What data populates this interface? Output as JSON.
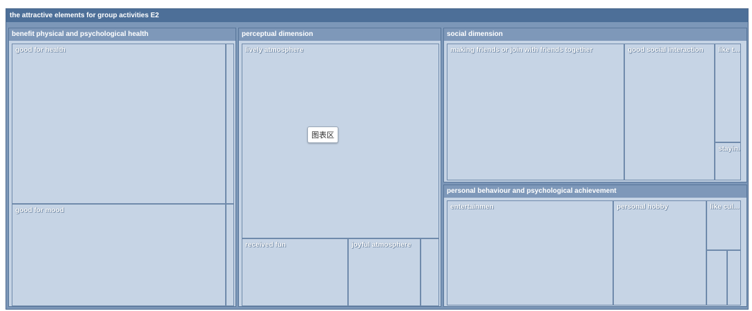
{
  "chart_data": {
    "type": "treemap",
    "title": "the attractive elements for group activities E2",
    "plot_area_label": "图表区",
    "groups": [
      {
        "name": "benefit physical and psychological health",
        "children": [
          {
            "label": "good for health",
            "value": 26
          },
          {
            "label": "good for mood",
            "value": 16
          },
          {
            "label": "",
            "value": 1.6
          },
          {
            "label": "",
            "value": 1.1
          }
        ]
      },
      {
        "name": "perceptual dimension",
        "children": [
          {
            "label": "lively atmosphere",
            "value": 27
          },
          {
            "label": "received fun",
            "value": 7
          },
          {
            "label": "joyful atmosphere",
            "value": 4.6
          },
          {
            "label": "",
            "value": 1.2
          }
        ]
      },
      {
        "name": "social dimension",
        "children": [
          {
            "label": "making friends or join with friends together",
            "value": 16
          },
          {
            "label": "good social interaction",
            "value": 8.5
          },
          {
            "label": "like t...",
            "value": 3.8
          },
          {
            "label": "stayin...",
            "value": 1.2
          }
        ]
      },
      {
        "name": "personal behaviour and psychological achievement",
        "children": [
          {
            "label": "entertainmen",
            "value": 10.5
          },
          {
            "label": "personal hobby",
            "value": 6.1
          },
          {
            "label": "like cul...",
            "value": 1.9
          },
          {
            "label": "",
            "value": 0.9
          },
          {
            "label": "",
            "value": 0.9
          }
        ]
      }
    ]
  }
}
